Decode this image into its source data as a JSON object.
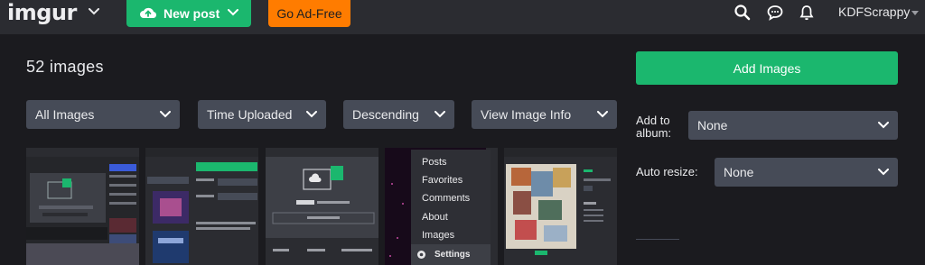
{
  "header": {
    "logo": "imgur",
    "new_post_label": "New post",
    "ad_free_label": "Go Ad-Free",
    "username": "KDFScrappy"
  },
  "main": {
    "image_count": "52 images",
    "filters": [
      {
        "label": "All Images"
      },
      {
        "label": "Time Uploaded"
      },
      {
        "label": "Descending"
      },
      {
        "label": "View Image Info"
      }
    ],
    "thumbnail_menu": [
      "Posts",
      "Favorites",
      "Comments",
      "About",
      "Images",
      "Settings"
    ]
  },
  "sidebar": {
    "add_images_label": "Add Images",
    "add_to_album_label": "Add to album:",
    "add_to_album_value": "None",
    "auto_resize_label": "Auto resize:",
    "auto_resize_value": "None"
  },
  "colors": {
    "background": "#1b1b1f",
    "topbar": "#2b2c31",
    "accent_green": "#1bb76e",
    "accent_orange": "#ff7c00",
    "dropdown": "#464b57"
  },
  "icons": [
    "chevron-down-icon",
    "upload-icon",
    "search-icon",
    "chat-icon",
    "bell-icon",
    "caret-down-icon",
    "gear-icon"
  ]
}
